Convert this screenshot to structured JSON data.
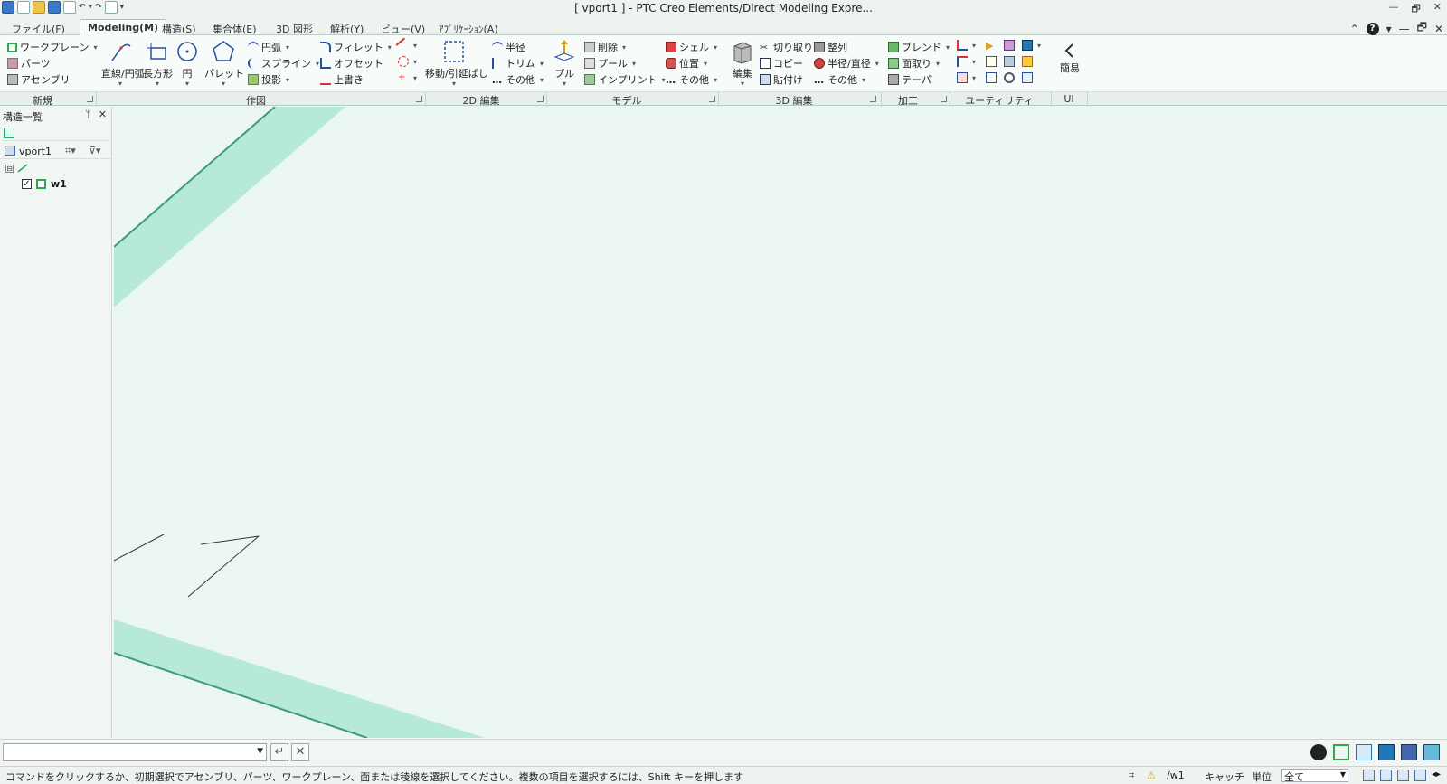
{
  "window": {
    "title": "[ vport1 ] - PTC Creo Elements/Direct Modeling Expre...",
    "controls": [
      "—",
      "🗗",
      "✕"
    ]
  },
  "menu_tabs": [
    {
      "label": "ファイル(F)",
      "active": false
    },
    {
      "label": "Modeling(M)",
      "active": true
    },
    {
      "label": "構造(S)",
      "active": false
    },
    {
      "label": "集合体(E)",
      "active": false
    },
    {
      "label": "3D 図形",
      "active": false
    },
    {
      "label": "解析(Y)",
      "active": false
    },
    {
      "label": "ビュー(V)",
      "active": false
    },
    {
      "label": "ｱﾌﾟﾘｹｰｼｮﾝ(A)",
      "active": false
    }
  ],
  "ribbon": {
    "new": {
      "workplane": "ワークプレーン",
      "parts": "パーツ",
      "assembly": "アセンブリ"
    },
    "draw": {
      "line_arc": "直線/円弧",
      "rectangle": "長方形",
      "circle": "円",
      "pallet": "パレット",
      "arc": "円弧",
      "spline": "スプライン",
      "projection": "投影",
      "fillet": "フィレット",
      "offset": "オフセット",
      "overwrite": "上書き"
    },
    "edit2d": {
      "move_stretch": "移動/引延ばし",
      "radius": "半径",
      "trim": "トリム",
      "other": "その他"
    },
    "model": {
      "pull": "プル",
      "delete": "削除",
      "pool": "プール",
      "imprint": "インプリント"
    },
    "edit3d": {
      "shell": "シェル",
      "position": "位置",
      "other": "その他",
      "edit": "編集",
      "cut": "切り取り",
      "copy": "コピー",
      "paste": "貼付け"
    },
    "process": {
      "align": "整列",
      "radius_diameter": "半径/直径",
      "other": "その他",
      "blend": "ブレンド",
      "chamfer": "面取り",
      "taper": "テーパ"
    },
    "ui": {
      "simple": "簡易"
    }
  },
  "ribbon_groups": [
    "新規",
    "作図",
    "2D 編集",
    "モデル",
    "3D 編集",
    "加工",
    "ユーティリティ",
    "UI"
  ],
  "structure_panel": {
    "title": "構造一覧",
    "pin": "ᛘ",
    "close": "✕",
    "viewport": "vport1",
    "tree": {
      "expander": "⊟",
      "item": "w1",
      "checked": "✓"
    }
  },
  "command": {
    "input_value": "",
    "enter": "↵",
    "cancel": "✕"
  },
  "status": {
    "message": "コマンドをクリックするか、初期選択でアセンブリ、パーツ、ワークプレーン、面または稜線を選択してください。複数の項目を選択するには、Shift キーを押します",
    "workplane": "/w1",
    "catch": "キャッチ",
    "unit": "単位",
    "filter_value": "全て"
  },
  "colors": {
    "viewport_bg": "#ecf7f4",
    "band_fill": "#b6e9da",
    "band_edge": "#3e9a77",
    "accent": "#3a78c8"
  }
}
